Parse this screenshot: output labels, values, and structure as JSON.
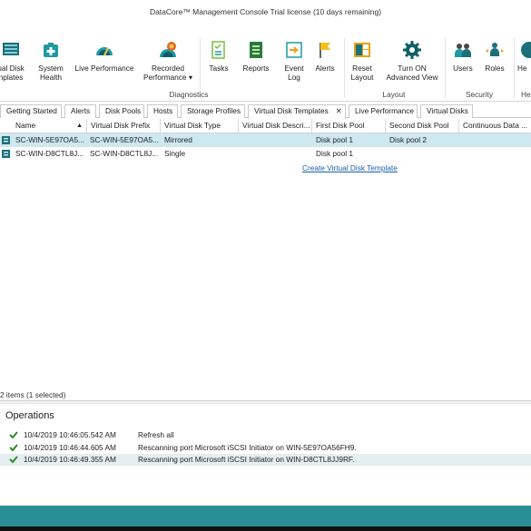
{
  "window": {
    "title": "DataCore™ Management Console   Trial license (10 days remaining)"
  },
  "ribbon": {
    "buttons": [
      {
        "label": "ual Disk\nnplates",
        "icon": "virtual-disk-templates-icon"
      },
      {
        "label": "System\nHealth",
        "icon": "system-health-icon"
      },
      {
        "label": "Live Performance",
        "icon": "live-performance-icon"
      },
      {
        "label": "Recorded\nPerformance ▾",
        "icon": "recorded-performance-icon"
      },
      {
        "label": "Tasks",
        "icon": "tasks-icon"
      },
      {
        "label": "Reports",
        "icon": "reports-icon"
      },
      {
        "label": "Event\nLog",
        "icon": "event-log-icon"
      },
      {
        "label": "Alerts",
        "icon": "alerts-flag-icon"
      },
      {
        "label": "Reset\nLayout",
        "icon": "reset-layout-icon"
      },
      {
        "label": "Turn ON\nAdvanced View",
        "icon": "advanced-view-gear-icon"
      },
      {
        "label": "Users",
        "icon": "users-icon"
      },
      {
        "label": "Roles",
        "icon": "roles-icon"
      },
      {
        "label": "He",
        "icon": "help-icon"
      }
    ],
    "groups": {
      "diagnostics": "Diagnostics",
      "layout": "Layout",
      "security": "Security",
      "help": "He"
    }
  },
  "tabs": [
    {
      "label": "Getting Started"
    },
    {
      "label": "Alerts"
    },
    {
      "label": "Disk Pools"
    },
    {
      "label": "Hosts"
    },
    {
      "label": "Storage Profiles"
    },
    {
      "label": "Virtual Disk Templates",
      "active": true,
      "close": "✕"
    },
    {
      "label": "Live Performance"
    },
    {
      "label": "Virtual Disks"
    }
  ],
  "grid": {
    "columns": [
      "Name",
      "Virtual Disk Prefix",
      "Virtual Disk Type",
      "Virtual Disk Descri...",
      "First Disk Pool",
      "Second Disk Pool",
      "Continuous Data ..."
    ],
    "sort_indicator": "▲",
    "rows": [
      {
        "name": "SC-WIN-5E97OA5...",
        "prefix": "SC-WIN-5E97OA5...",
        "type": "Mirrored",
        "description": "",
        "first_pool": "Disk pool 1",
        "second_pool": "Disk pool 2",
        "cdp": "",
        "selected": true
      },
      {
        "name": "SC-WIN-D8CTL8J...",
        "prefix": "SC-WIN-D8CTL8J...",
        "type": "Single",
        "description": "",
        "first_pool": "Disk pool 1",
        "second_pool": "",
        "cdp": "",
        "selected": false
      }
    ],
    "create_link": "Create Virtual Disk Template",
    "status": "2 items (1 selected)"
  },
  "operations": {
    "title": "Operations",
    "items": [
      {
        "time": "10/4/2019 10:46:05.542 AM",
        "message": "Refresh all"
      },
      {
        "time": "10/4/2019 10:46:44.605 AM",
        "message": "Rescanning port Microsoft iSCSI Initiator on WIN-5E97OA56FH9."
      },
      {
        "time": "10/4/2019 10:46:49.355 AM",
        "message": "Rescanning port Microsoft iSCSI Initiator on WIN-D8CTL8JJ9RF."
      }
    ]
  },
  "colors": {
    "accent": "#2a8f95",
    "selection": "#cde8f0",
    "link": "#1a5fa8",
    "check": "#2e8b2e"
  }
}
